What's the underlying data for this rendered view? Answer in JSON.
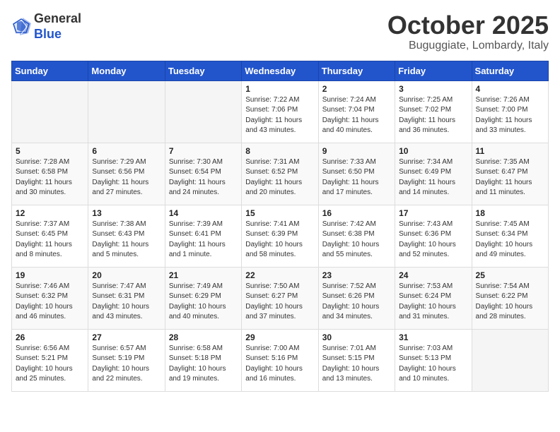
{
  "header": {
    "logo_general": "General",
    "logo_blue": "Blue",
    "month": "October 2025",
    "location": "Buguggiate, Lombardy, Italy"
  },
  "days_of_week": [
    "Sunday",
    "Monday",
    "Tuesday",
    "Wednesday",
    "Thursday",
    "Friday",
    "Saturday"
  ],
  "weeks": [
    [
      {
        "day": "",
        "info": ""
      },
      {
        "day": "",
        "info": ""
      },
      {
        "day": "",
        "info": ""
      },
      {
        "day": "1",
        "info": "Sunrise: 7:22 AM\nSunset: 7:06 PM\nDaylight: 11 hours\nand 43 minutes."
      },
      {
        "day": "2",
        "info": "Sunrise: 7:24 AM\nSunset: 7:04 PM\nDaylight: 11 hours\nand 40 minutes."
      },
      {
        "day": "3",
        "info": "Sunrise: 7:25 AM\nSunset: 7:02 PM\nDaylight: 11 hours\nand 36 minutes."
      },
      {
        "day": "4",
        "info": "Sunrise: 7:26 AM\nSunset: 7:00 PM\nDaylight: 11 hours\nand 33 minutes."
      }
    ],
    [
      {
        "day": "5",
        "info": "Sunrise: 7:28 AM\nSunset: 6:58 PM\nDaylight: 11 hours\nand 30 minutes."
      },
      {
        "day": "6",
        "info": "Sunrise: 7:29 AM\nSunset: 6:56 PM\nDaylight: 11 hours\nand 27 minutes."
      },
      {
        "day": "7",
        "info": "Sunrise: 7:30 AM\nSunset: 6:54 PM\nDaylight: 11 hours\nand 24 minutes."
      },
      {
        "day": "8",
        "info": "Sunrise: 7:31 AM\nSunset: 6:52 PM\nDaylight: 11 hours\nand 20 minutes."
      },
      {
        "day": "9",
        "info": "Sunrise: 7:33 AM\nSunset: 6:50 PM\nDaylight: 11 hours\nand 17 minutes."
      },
      {
        "day": "10",
        "info": "Sunrise: 7:34 AM\nSunset: 6:49 PM\nDaylight: 11 hours\nand 14 minutes."
      },
      {
        "day": "11",
        "info": "Sunrise: 7:35 AM\nSunset: 6:47 PM\nDaylight: 11 hours\nand 11 minutes."
      }
    ],
    [
      {
        "day": "12",
        "info": "Sunrise: 7:37 AM\nSunset: 6:45 PM\nDaylight: 11 hours\nand 8 minutes."
      },
      {
        "day": "13",
        "info": "Sunrise: 7:38 AM\nSunset: 6:43 PM\nDaylight: 11 hours\nand 5 minutes."
      },
      {
        "day": "14",
        "info": "Sunrise: 7:39 AM\nSunset: 6:41 PM\nDaylight: 11 hours\nand 1 minute."
      },
      {
        "day": "15",
        "info": "Sunrise: 7:41 AM\nSunset: 6:39 PM\nDaylight: 10 hours\nand 58 minutes."
      },
      {
        "day": "16",
        "info": "Sunrise: 7:42 AM\nSunset: 6:38 PM\nDaylight: 10 hours\nand 55 minutes."
      },
      {
        "day": "17",
        "info": "Sunrise: 7:43 AM\nSunset: 6:36 PM\nDaylight: 10 hours\nand 52 minutes."
      },
      {
        "day": "18",
        "info": "Sunrise: 7:45 AM\nSunset: 6:34 PM\nDaylight: 10 hours\nand 49 minutes."
      }
    ],
    [
      {
        "day": "19",
        "info": "Sunrise: 7:46 AM\nSunset: 6:32 PM\nDaylight: 10 hours\nand 46 minutes."
      },
      {
        "day": "20",
        "info": "Sunrise: 7:47 AM\nSunset: 6:31 PM\nDaylight: 10 hours\nand 43 minutes."
      },
      {
        "day": "21",
        "info": "Sunrise: 7:49 AM\nSunset: 6:29 PM\nDaylight: 10 hours\nand 40 minutes."
      },
      {
        "day": "22",
        "info": "Sunrise: 7:50 AM\nSunset: 6:27 PM\nDaylight: 10 hours\nand 37 minutes."
      },
      {
        "day": "23",
        "info": "Sunrise: 7:52 AM\nSunset: 6:26 PM\nDaylight: 10 hours\nand 34 minutes."
      },
      {
        "day": "24",
        "info": "Sunrise: 7:53 AM\nSunset: 6:24 PM\nDaylight: 10 hours\nand 31 minutes."
      },
      {
        "day": "25",
        "info": "Sunrise: 7:54 AM\nSunset: 6:22 PM\nDaylight: 10 hours\nand 28 minutes."
      }
    ],
    [
      {
        "day": "26",
        "info": "Sunrise: 6:56 AM\nSunset: 5:21 PM\nDaylight: 10 hours\nand 25 minutes."
      },
      {
        "day": "27",
        "info": "Sunrise: 6:57 AM\nSunset: 5:19 PM\nDaylight: 10 hours\nand 22 minutes."
      },
      {
        "day": "28",
        "info": "Sunrise: 6:58 AM\nSunset: 5:18 PM\nDaylight: 10 hours\nand 19 minutes."
      },
      {
        "day": "29",
        "info": "Sunrise: 7:00 AM\nSunset: 5:16 PM\nDaylight: 10 hours\nand 16 minutes."
      },
      {
        "day": "30",
        "info": "Sunrise: 7:01 AM\nSunset: 5:15 PM\nDaylight: 10 hours\nand 13 minutes."
      },
      {
        "day": "31",
        "info": "Sunrise: 7:03 AM\nSunset: 5:13 PM\nDaylight: 10 hours\nand 10 minutes."
      },
      {
        "day": "",
        "info": ""
      }
    ]
  ]
}
